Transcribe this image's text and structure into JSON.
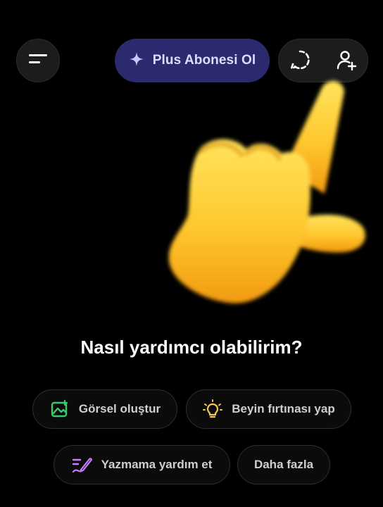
{
  "header": {
    "menu_icon": "menu-icon",
    "subscribe_label": "Plus Abonesi Ol",
    "subscribe_icon": "sparkle-icon",
    "temporary_chat_icon": "dashed-circle-chat-icon",
    "add_user_icon": "add-user-icon"
  },
  "illustration": {
    "name": "pointing-up-hand-emoji"
  },
  "main": {
    "heading": "Nasıl yardımcı olabilirim?"
  },
  "suggestions": [
    {
      "label": "Görsel oluştur",
      "icon": "image-icon",
      "color": "#38c96a"
    },
    {
      "label": "Beyin fırtınası yap",
      "icon": "lightbulb-icon",
      "color": "#f2c94c"
    },
    {
      "label": "Yazmama yardım et",
      "icon": "pen-icon",
      "color": "#c77dff"
    },
    {
      "label": "Daha fazla",
      "icon": "",
      "color": ""
    }
  ],
  "colors": {
    "background": "#000000",
    "accent": "#2c2a6e",
    "accent_text": "#dcdcff"
  }
}
